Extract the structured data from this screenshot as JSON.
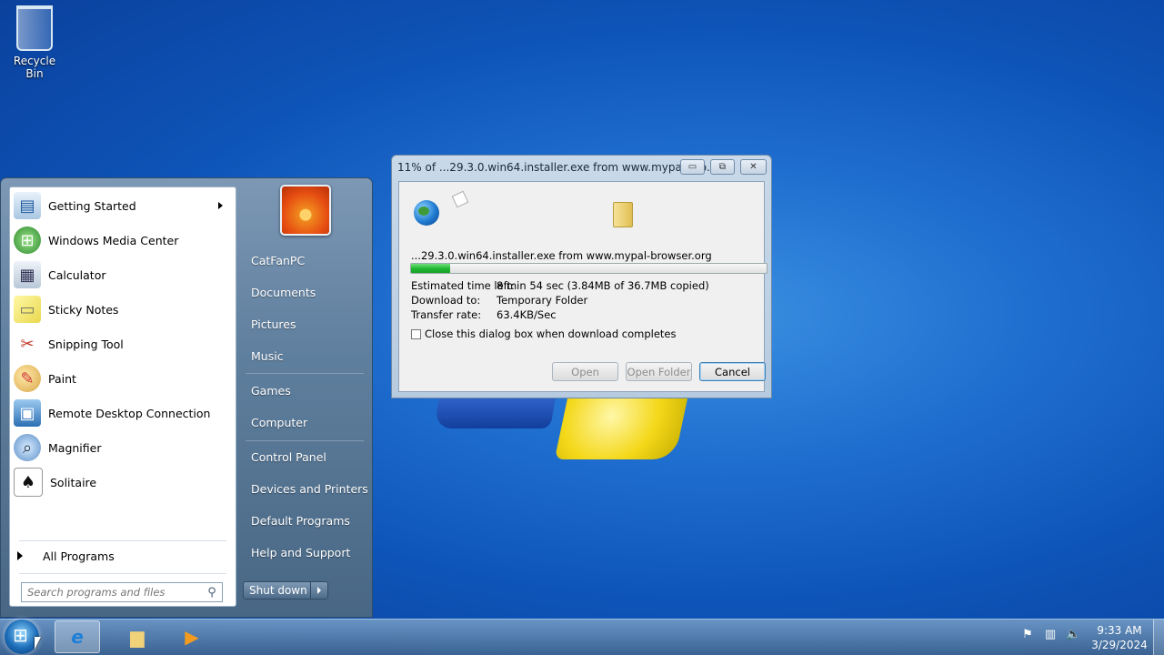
{
  "desktop": {
    "icons": [
      {
        "label": "Recycle Bin",
        "icon": "recycle-bin-icon"
      }
    ]
  },
  "start_menu": {
    "programs": [
      {
        "label": "Getting Started",
        "icon": "getting-started-icon",
        "has_submenu": true
      },
      {
        "label": "Windows Media Center",
        "icon": "windows-media-center-icon"
      },
      {
        "label": "Calculator",
        "icon": "calculator-icon"
      },
      {
        "label": "Sticky Notes",
        "icon": "sticky-notes-icon"
      },
      {
        "label": "Snipping Tool",
        "icon": "snipping-tool-icon"
      },
      {
        "label": "Paint",
        "icon": "paint-icon"
      },
      {
        "label": "Remote Desktop Connection",
        "icon": "remote-desktop-icon"
      },
      {
        "label": "Magnifier",
        "icon": "magnifier-icon"
      },
      {
        "label": "Solitaire",
        "icon": "solitaire-icon"
      }
    ],
    "all_programs": "All Programs",
    "search_placeholder": "Search programs and files",
    "right_items": [
      "CatFanPC",
      "Documents",
      "Pictures",
      "Music",
      "Games",
      "Computer",
      "Control Panel",
      "Devices and Printers",
      "Default Programs",
      "Help and Support"
    ],
    "shutdown_label": "Shut down"
  },
  "download_dialog": {
    "title": "11% of ...29.3.0.win64.installer.exe from www.mypal-bro...",
    "file_line": "...29.3.0.win64.installer.exe from www.mypal-browser.org",
    "progress": 0.11,
    "details": [
      {
        "key": "Estimated time left:",
        "value": "8 min 54 sec (3.84MB of 36.7MB copied)"
      },
      {
        "key": "Download to:",
        "value": "Temporary Folder"
      },
      {
        "key": "Transfer rate:",
        "value": "63.4KB/Sec"
      }
    ],
    "close_checkbox_label": "Close this dialog box when download completes",
    "buttons": {
      "open": "Open",
      "open_folder": "Open Folder",
      "cancel": "Cancel"
    }
  },
  "taskbar": {
    "pinned": [
      {
        "name": "internet-explorer",
        "icon": "internet-explorer-icon",
        "active": true
      },
      {
        "name": "file-explorer",
        "icon": "folder-icon"
      },
      {
        "name": "media-player",
        "icon": "media-player-icon"
      }
    ],
    "clock": {
      "time": "9:33 AM",
      "date": "3/29/2024"
    }
  }
}
